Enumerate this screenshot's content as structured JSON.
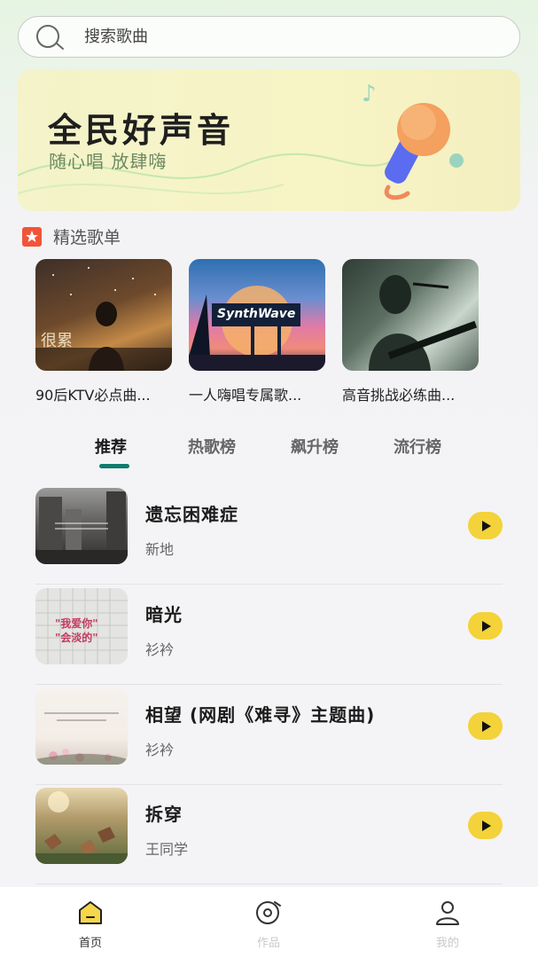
{
  "search": {
    "placeholder": "搜索歌曲",
    "icon": "search-icon"
  },
  "banner": {
    "title": "全民好声音",
    "subtitle": "随心唱 放肆嗨"
  },
  "section": {
    "title": "精选歌单"
  },
  "playlists": [
    {
      "name": "90后KTV必点曲...",
      "cover_text": "很累"
    },
    {
      "name": "一人嗨唱专属歌...",
      "cover_text": "SynthWave"
    },
    {
      "name": "高音挑战必练曲..."
    }
  ],
  "tabs": [
    {
      "label": "推荐",
      "active": true
    },
    {
      "label": "热歌榜",
      "active": false
    },
    {
      "label": "飙升榜",
      "active": false
    },
    {
      "label": "流行榜",
      "active": false
    }
  ],
  "songs": [
    {
      "title": "遗忘困难症",
      "artist": "新地"
    },
    {
      "title": "暗光",
      "artist": "衫衿",
      "cover_text": "\"我爱你\" \"会淡的\""
    },
    {
      "title": "相望 (网剧《难寻》主题曲)",
      "artist": "衫衿"
    },
    {
      "title": "拆穿",
      "artist": "王同学"
    }
  ],
  "nav": [
    {
      "label": "首页",
      "icon": "home-icon",
      "active": true
    },
    {
      "label": "作品",
      "icon": "disc-icon",
      "active": false
    },
    {
      "label": "我的",
      "icon": "user-icon",
      "active": false
    }
  ],
  "colors": {
    "accent": "#0e7b6d",
    "play": "#f3d23a",
    "star": "#f0543a",
    "home_icon": "#f6d74a"
  }
}
